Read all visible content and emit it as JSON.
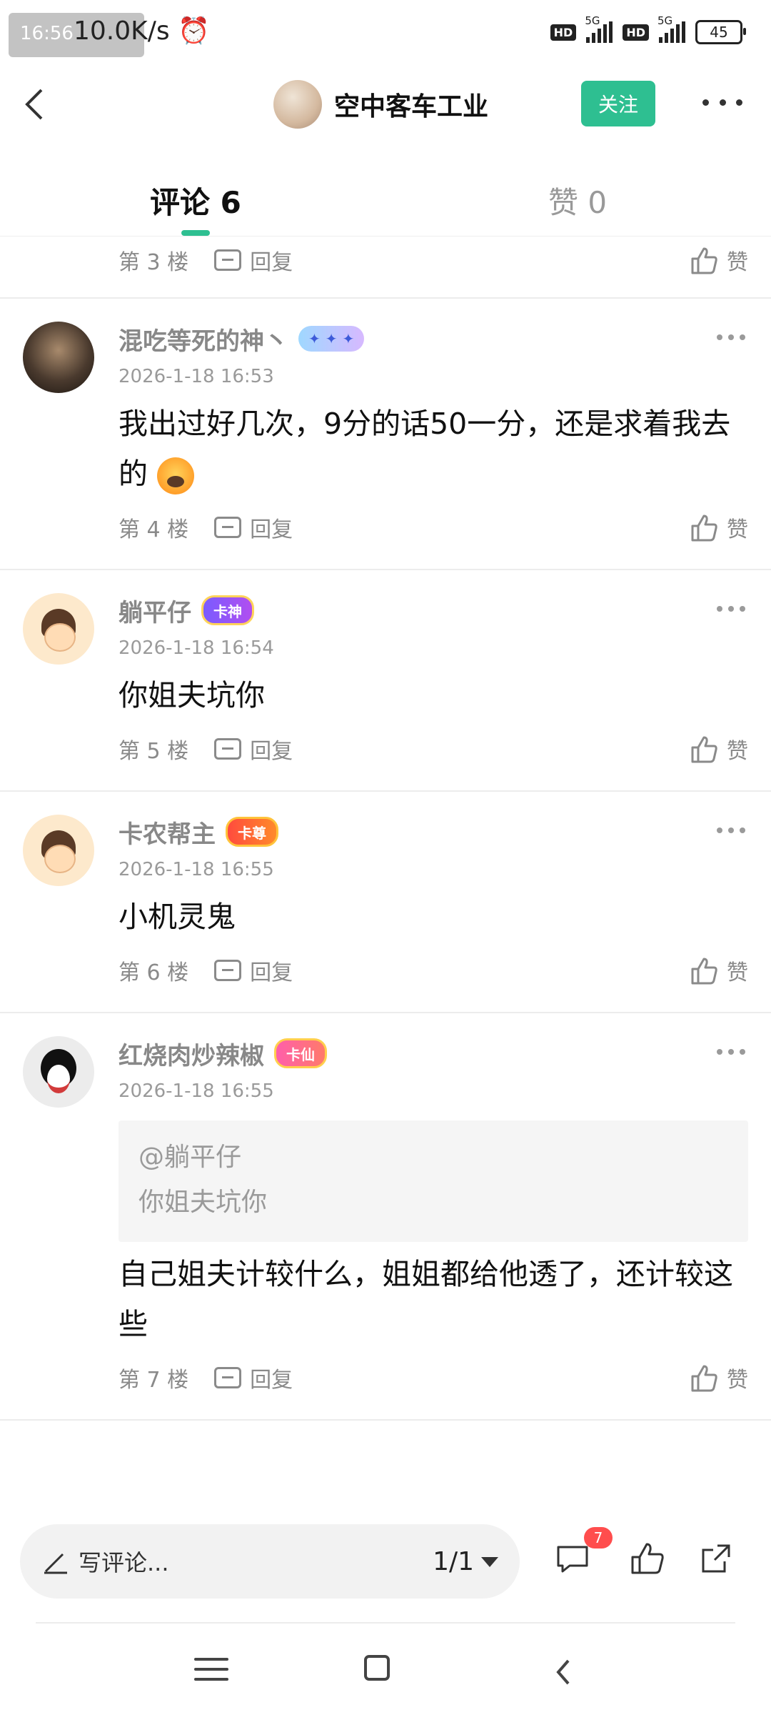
{
  "status_bar": {
    "time": "16:56",
    "speed": "10.0K/s",
    "alarm_icon": "alarm-icon",
    "hd1": "HD",
    "net1": "5G",
    "hd2": "HD",
    "net2": "5G",
    "battery": "45"
  },
  "header": {
    "title": "空中客车工业",
    "follow_label": "关注",
    "back_icon": "chevron-left-icon",
    "more_icon": "more-horizontal-icon"
  },
  "tabs": {
    "comments_label": "评论 6",
    "likes_label": "赞 0"
  },
  "comments": [
    {
      "floor": "第 3 楼",
      "reply_label": "回复",
      "like_label": "赞"
    },
    {
      "user": "混吃等死的神丶",
      "badge": "",
      "time": "2026-1-18 16:53",
      "text": "我出过好几次，9分的话50一分，还是求着我去的",
      "floor": "第 4 楼",
      "reply_label": "回复",
      "like_label": "赞"
    },
    {
      "user": "躺平仔",
      "badge": "卡神",
      "time": "2026-1-18 16:54",
      "text": "你姐夫坑你",
      "floor": "第 5 楼",
      "reply_label": "回复",
      "like_label": "赞"
    },
    {
      "user": "卡农帮主",
      "badge": "卡尊",
      "time": "2026-1-18 16:55",
      "text": "小机灵鬼",
      "floor": "第 6 楼",
      "reply_label": "回复",
      "like_label": "赞"
    },
    {
      "user": "红烧肉炒辣椒",
      "badge": "卡仙",
      "time": "2026-1-18 16:55",
      "quote_user": "@躺平仔",
      "quote_text": "你姐夫坑你",
      "text": "自己姐夫计较什么，姐姐都给他透了，还计较这些",
      "floor": "第 7 楼",
      "reply_label": "回复",
      "like_label": "赞"
    }
  ],
  "bottom_bar": {
    "input_placeholder": "写评论...",
    "page": "1/1",
    "comment_count": "7",
    "icons": [
      "comment-icon",
      "thumb-up-icon",
      "share-icon"
    ]
  },
  "colors": {
    "accent": "#2ebf91",
    "badge_red": "#ff4d4d"
  }
}
